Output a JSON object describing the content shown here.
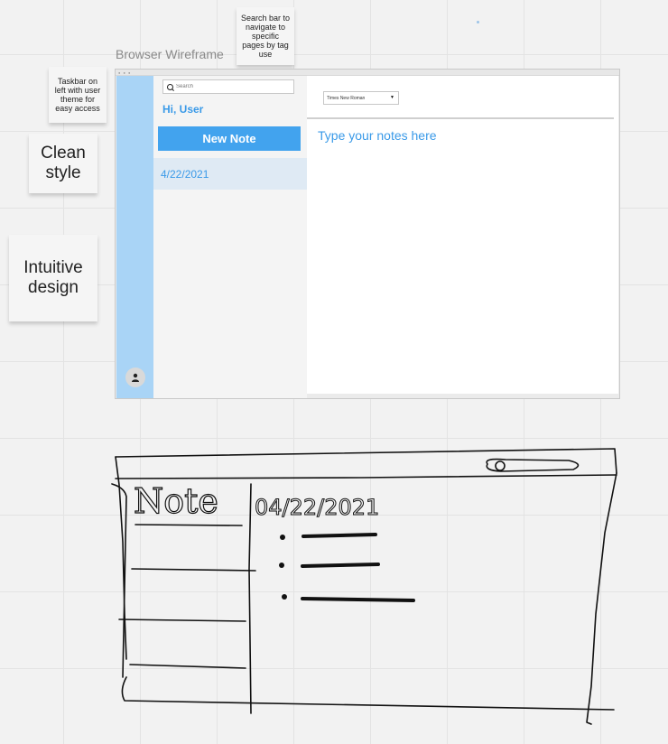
{
  "stickies": {
    "search_note": "Search bar to navigate to specific pages by tag use",
    "taskbar_note": "Taskbar on left with user theme for easy access",
    "clean_style": "Clean style",
    "intuitive_design": "Intuitive design"
  },
  "frame": {
    "title": "Browser Wireframe"
  },
  "app": {
    "search_placeholder": "Search",
    "greeting": "Hi, User",
    "new_note_label": "New Note",
    "notes": [
      "4/22/2021"
    ],
    "font_select_value": "Times New Roman",
    "editor_placeholder": "Type your notes here",
    "avatar_icon": "user-icon"
  },
  "sketch": {
    "heading": "Note",
    "date": "04/22/2021"
  }
}
